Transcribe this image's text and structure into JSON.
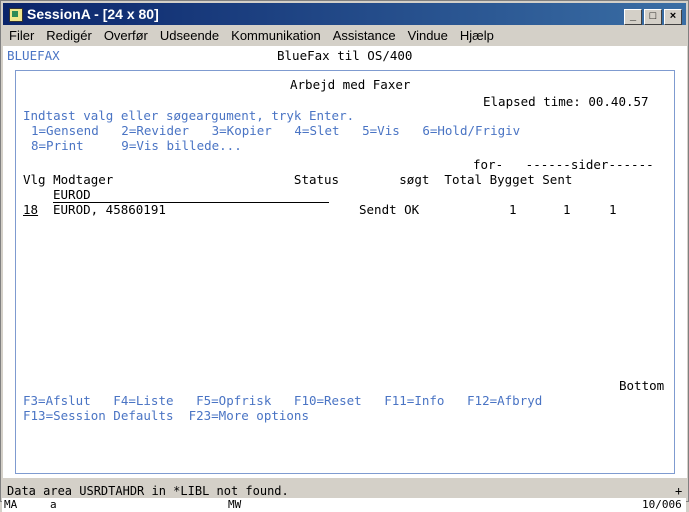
{
  "window": {
    "title": "SessionA - [24 x 80]",
    "min": "_",
    "max": "□",
    "close": "×"
  },
  "menu": [
    "Filer",
    "Redigér",
    "Overfør",
    "Udseende",
    "Kommunikation",
    "Assistance",
    "Vindue",
    "Hjælp"
  ],
  "screen": {
    "app_id": "BLUEFAX",
    "app_title": "BlueFax til OS/400",
    "panel_title": "Arbejd med Faxer",
    "elapsed": "Elapsed time: 00.40.57",
    "instructions": "Indtast valg eller søgeargument, tryk Enter.",
    "options1": "1=Gensend   2=Revider   3=Kopier   4=Slet   5=Vis   6=Hold/Frigiv",
    "options2": "8=Print     9=Vis billede...",
    "col_header_top": "for-   ------sider------",
    "col_header": "Vlg Modtager                        Status        søgt  Total Bygget Sent",
    "search_value": "EUROD",
    "row": {
      "vlg": "18",
      "modtager": "EUROD, 45860191",
      "status": "Sendt OK",
      "forsogt": "1",
      "total": "1",
      "bygget": "1",
      "sent": ""
    },
    "bottom": "Bottom",
    "fkeys1": "F3=Afslut   F4=Liste   F5=Opfrisk   F10=Reset   F11=Info   F12=Afbryd",
    "fkeys2": "F13=Session Defaults  F23=More options"
  },
  "status": {
    "message": "Data area USRDTAHDR in *LIBL not found.",
    "plus": "+"
  },
  "oia": {
    "ma": "MA",
    "a": "a",
    "mw": "MW",
    "pos": "10/006"
  }
}
